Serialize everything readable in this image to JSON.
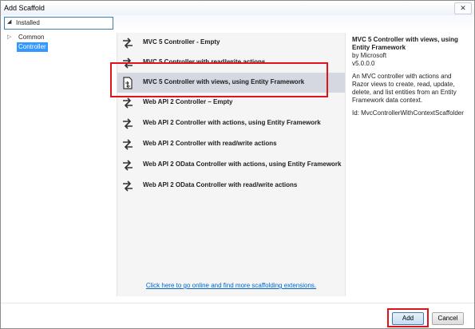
{
  "window": {
    "title": "Add Scaffold",
    "close_glyph": "✕"
  },
  "installed": {
    "label": "Installed"
  },
  "tree": [
    {
      "label": "Common",
      "expandable": true,
      "selected": false
    },
    {
      "label": "Controller",
      "expandable": false,
      "selected": true
    }
  ],
  "list": {
    "items": [
      {
        "label": "MVC 5 Controller - Empty",
        "icon": "controller-icon"
      },
      {
        "label": "MVC 5 Controller with read/write actions",
        "icon": "controller-icon"
      },
      {
        "label": "MVC 5 Controller with views, using Entity Framework",
        "icon": "controller-views-icon"
      },
      {
        "label": "Web API 2 Controller – Empty",
        "icon": "controller-icon"
      },
      {
        "label": "Web API 2 Controller with actions, using Entity Framework",
        "icon": "controller-icon"
      },
      {
        "label": "Web API 2 Controller with read/write actions",
        "icon": "controller-icon"
      },
      {
        "label": "Web API 2 OData Controller with actions, using Entity Framework",
        "icon": "controller-icon"
      },
      {
        "label": "Web API 2 OData Controller with read/write actions",
        "icon": "controller-icon"
      }
    ],
    "selected_index": 2,
    "online_link": "Click here to go online and find more scaffolding extensions."
  },
  "details": {
    "title": "MVC 5 Controller with views, using Entity Framework",
    "author": "by Microsoft",
    "version": "v5.0.0.0",
    "description": "An MVC controller with actions and Razor views to create, read, update, delete, and list entities from an Entity Framework data context.",
    "id": "Id: MvcControllerWithContextScaffolder"
  },
  "buttons": {
    "add": "Add",
    "cancel": "Cancel"
  },
  "colors": {
    "highlight": "#e0121a",
    "selection": "#3399ff",
    "link": "#0066cc"
  }
}
